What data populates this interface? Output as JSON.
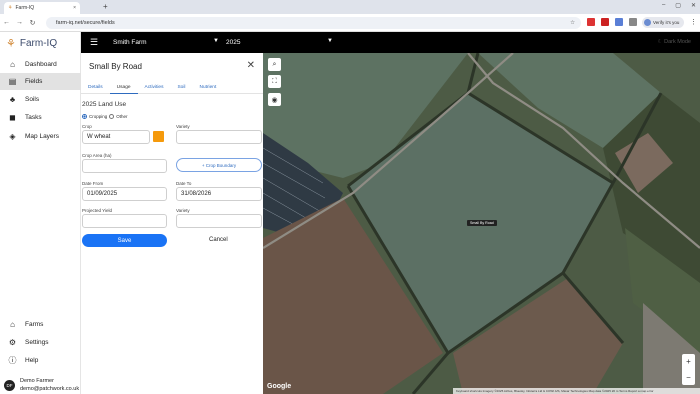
{
  "browser": {
    "tab_title": "Farm-IQ",
    "tab_close": "×",
    "new_tab": "+",
    "url": "farm-iq.net/secure/fields",
    "verify_label": "Verify it's you"
  },
  "app": {
    "logo_text": "Farm-IQ",
    "nav": [
      {
        "label": "Dashboard",
        "icon": "home-icon"
      },
      {
        "label": "Fields",
        "icon": "map-icon"
      },
      {
        "label": "Soils",
        "icon": "soil-icon"
      },
      {
        "label": "Tasks",
        "icon": "truck-icon"
      },
      {
        "label": "Map Layers",
        "icon": "layers-icon"
      }
    ],
    "bottom_nav": [
      {
        "label": "Farms",
        "icon": "farm-icon"
      },
      {
        "label": "Settings",
        "icon": "gear-icon"
      },
      {
        "label": "Help",
        "icon": "help-icon"
      }
    ],
    "user": {
      "initials": "DF",
      "name": "Demo Farmer",
      "email": "demo@patchwork.co.uk"
    }
  },
  "topbar": {
    "farm": "Smith Farm",
    "year": "2025",
    "dark_mode": "Dark Mode"
  },
  "panel": {
    "title": "Small By Road",
    "tabs": [
      "Details",
      "Usage",
      "Activities",
      "Soil",
      "Nutrient"
    ],
    "active_tab": "Usage",
    "section_title": "2025 Land Use",
    "radio_cropping": "Cropping",
    "radio_other": "Other",
    "crop_label": "Crop",
    "crop_value": "W wheat",
    "crop_color": "#f59a0c",
    "variety_label": "Variety",
    "variety_value": "",
    "crop_area_label": "Crop Area (ha)",
    "crop_area_value": "",
    "crop_boundary_button": "+ Crop Boundary",
    "date_from_label": "Date From",
    "date_from_value": "01/09/2025",
    "date_to_label": "Date To",
    "date_to_value": "31/08/2026",
    "projected_yield_label": "Projected Yield",
    "projected_yield_value": "",
    "variety2_label": "Variety",
    "variety2_value": "",
    "save_label": "Save",
    "cancel_label": "Cancel"
  },
  "map": {
    "field_label": "Small By Road",
    "google": "Google",
    "attribution": "Keyboard shortcuts   Imagery ©2025 Airbus, Bluesky, Infoterra Ltd & COWI A/S, Maxar Technologies   Map data ©2025   20 m   Terms   Report a map error"
  }
}
